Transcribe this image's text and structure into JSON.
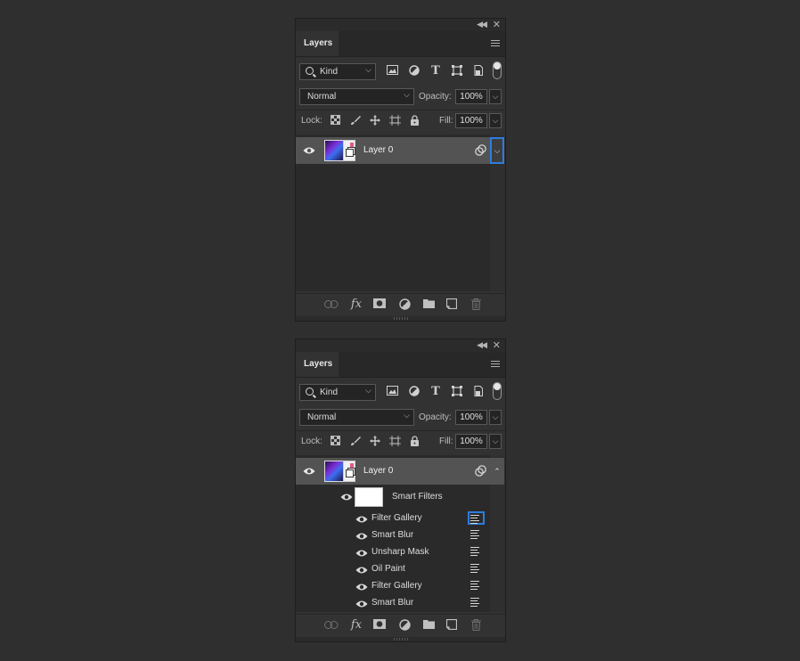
{
  "panels": [
    {
      "tab_label": "Layers",
      "filter": {
        "kind_label": "Kind"
      },
      "blend_mode": "Normal",
      "opacity_label": "Opacity:",
      "opacity_value": "100%",
      "lock_label": "Lock:",
      "fill_label": "Fill:",
      "fill_value": "100%",
      "layer": {
        "name": "Layer 0",
        "expanded": false
      }
    },
    {
      "tab_label": "Layers",
      "filter": {
        "kind_label": "Kind"
      },
      "blend_mode": "Normal",
      "opacity_label": "Opacity:",
      "opacity_value": "100%",
      "lock_label": "Lock:",
      "fill_label": "Fill:",
      "fill_value": "100%",
      "layer": {
        "name": "Layer 0",
        "expanded": true
      },
      "smart_filters_label": "Smart Filters",
      "filters": [
        {
          "name": "Filter Gallery",
          "highlighted": true
        },
        {
          "name": "Smart Blur",
          "highlighted": false
        },
        {
          "name": "Unsharp Mask",
          "highlighted": false
        },
        {
          "name": "Oil Paint",
          "highlighted": false
        },
        {
          "name": "Filter Gallery",
          "highlighted": false
        },
        {
          "name": "Smart Blur",
          "highlighted": false
        }
      ]
    }
  ],
  "icons": {
    "filter_icons": [
      "image-icon",
      "adjustment-icon",
      "type-icon",
      "shape-icon",
      "smart-object-icon"
    ],
    "lock_icons": [
      "lock-transparent-icon",
      "lock-brush-icon",
      "lock-move-icon",
      "lock-artboard-icon",
      "lock-all-icon"
    ],
    "footer_icons": [
      "link-icon",
      "fx-icon",
      "mask-icon",
      "adjustment-layer-icon",
      "group-folder-icon",
      "new-layer-icon",
      "trash-icon"
    ]
  },
  "colors": {
    "highlight": "#2b7de0",
    "selected_row": "#535353",
    "panel_bg": "#323232"
  }
}
